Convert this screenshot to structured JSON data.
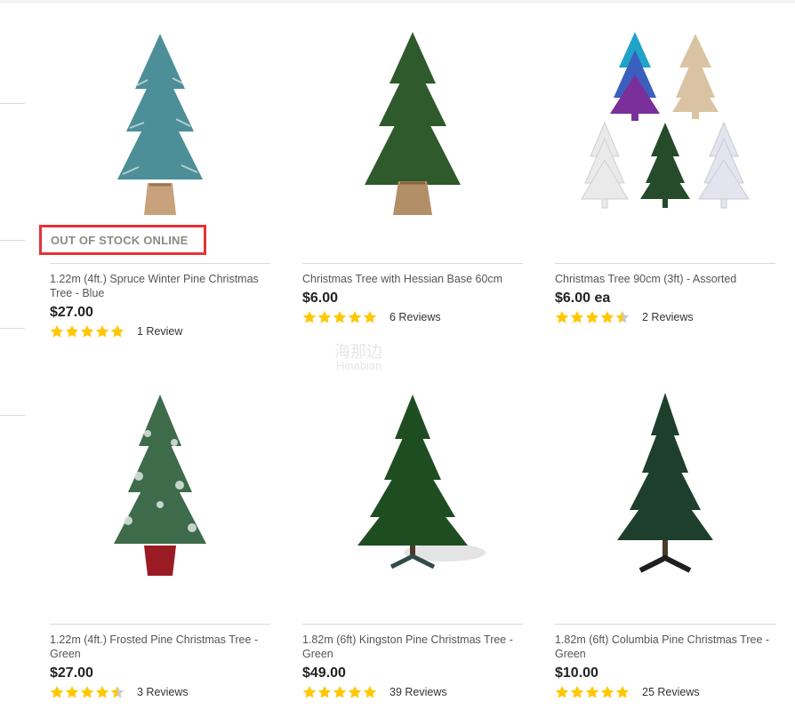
{
  "watermark": {
    "title": "海那边",
    "subtitle": "Hinabian"
  },
  "products": [
    {
      "title": "1.22m (4ft.) Spruce Winter Pine Christmas Tree - Blue",
      "price": "$27.00",
      "rating": 5,
      "reviews": "1 Review",
      "badge": "OUT OF STOCK ONLINE",
      "image": "blue-spruce-tree-image"
    },
    {
      "title": "Christmas Tree with Hessian Base 60cm",
      "price": "$6.00",
      "rating": 5,
      "reviews": "6 Reviews",
      "image": "hessian-base-tree-image"
    },
    {
      "title": "Christmas Tree 90cm (3ft) - Assorted",
      "price": "$6.00 ea",
      "rating": 4.5,
      "reviews": "2 Reviews",
      "image": "assorted-trees-image"
    },
    {
      "title": "1.22m (4ft.) Frosted Pine Christmas Tree - Green",
      "price": "$27.00",
      "rating": 4.5,
      "reviews": "3 Reviews",
      "image": "frosted-pine-tree-image"
    },
    {
      "title": "1.82m (6ft) Kingston Pine Christmas Tree - Green",
      "price": "$49.00",
      "rating": 5,
      "reviews": "39 Reviews",
      "image": "kingston-pine-tree-image"
    },
    {
      "title": "1.82m (6ft) Columbia Pine Christmas Tree - Green",
      "price": "$10.00",
      "rating": 5,
      "reviews": "25 Reviews",
      "image": "columbia-pine-tree-image"
    }
  ],
  "colors": {
    "star": "#ffc800",
    "star_empty": "#c9c9c9",
    "badge_border": "#e53238"
  }
}
